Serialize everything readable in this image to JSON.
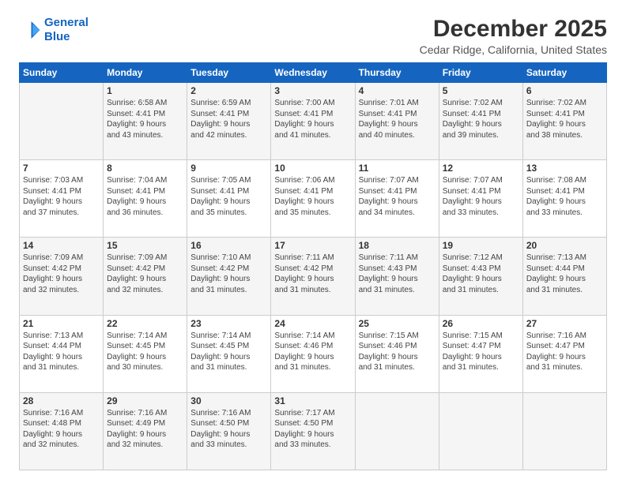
{
  "logo": {
    "line1": "General",
    "line2": "Blue"
  },
  "title": "December 2025",
  "subtitle": "Cedar Ridge, California, United States",
  "header_days": [
    "Sunday",
    "Monday",
    "Tuesday",
    "Wednesday",
    "Thursday",
    "Friday",
    "Saturday"
  ],
  "weeks": [
    [
      {
        "day": "",
        "info": ""
      },
      {
        "day": "1",
        "info": "Sunrise: 6:58 AM\nSunset: 4:41 PM\nDaylight: 9 hours\nand 43 minutes."
      },
      {
        "day": "2",
        "info": "Sunrise: 6:59 AM\nSunset: 4:41 PM\nDaylight: 9 hours\nand 42 minutes."
      },
      {
        "day": "3",
        "info": "Sunrise: 7:00 AM\nSunset: 4:41 PM\nDaylight: 9 hours\nand 41 minutes."
      },
      {
        "day": "4",
        "info": "Sunrise: 7:01 AM\nSunset: 4:41 PM\nDaylight: 9 hours\nand 40 minutes."
      },
      {
        "day": "5",
        "info": "Sunrise: 7:02 AM\nSunset: 4:41 PM\nDaylight: 9 hours\nand 39 minutes."
      },
      {
        "day": "6",
        "info": "Sunrise: 7:02 AM\nSunset: 4:41 PM\nDaylight: 9 hours\nand 38 minutes."
      }
    ],
    [
      {
        "day": "7",
        "info": "Sunrise: 7:03 AM\nSunset: 4:41 PM\nDaylight: 9 hours\nand 37 minutes."
      },
      {
        "day": "8",
        "info": "Sunrise: 7:04 AM\nSunset: 4:41 PM\nDaylight: 9 hours\nand 36 minutes."
      },
      {
        "day": "9",
        "info": "Sunrise: 7:05 AM\nSunset: 4:41 PM\nDaylight: 9 hours\nand 35 minutes."
      },
      {
        "day": "10",
        "info": "Sunrise: 7:06 AM\nSunset: 4:41 PM\nDaylight: 9 hours\nand 35 minutes."
      },
      {
        "day": "11",
        "info": "Sunrise: 7:07 AM\nSunset: 4:41 PM\nDaylight: 9 hours\nand 34 minutes."
      },
      {
        "day": "12",
        "info": "Sunrise: 7:07 AM\nSunset: 4:41 PM\nDaylight: 9 hours\nand 33 minutes."
      },
      {
        "day": "13",
        "info": "Sunrise: 7:08 AM\nSunset: 4:41 PM\nDaylight: 9 hours\nand 33 minutes."
      }
    ],
    [
      {
        "day": "14",
        "info": "Sunrise: 7:09 AM\nSunset: 4:42 PM\nDaylight: 9 hours\nand 32 minutes."
      },
      {
        "day": "15",
        "info": "Sunrise: 7:09 AM\nSunset: 4:42 PM\nDaylight: 9 hours\nand 32 minutes."
      },
      {
        "day": "16",
        "info": "Sunrise: 7:10 AM\nSunset: 4:42 PM\nDaylight: 9 hours\nand 31 minutes."
      },
      {
        "day": "17",
        "info": "Sunrise: 7:11 AM\nSunset: 4:42 PM\nDaylight: 9 hours\nand 31 minutes."
      },
      {
        "day": "18",
        "info": "Sunrise: 7:11 AM\nSunset: 4:43 PM\nDaylight: 9 hours\nand 31 minutes."
      },
      {
        "day": "19",
        "info": "Sunrise: 7:12 AM\nSunset: 4:43 PM\nDaylight: 9 hours\nand 31 minutes."
      },
      {
        "day": "20",
        "info": "Sunrise: 7:13 AM\nSunset: 4:44 PM\nDaylight: 9 hours\nand 31 minutes."
      }
    ],
    [
      {
        "day": "21",
        "info": "Sunrise: 7:13 AM\nSunset: 4:44 PM\nDaylight: 9 hours\nand 31 minutes."
      },
      {
        "day": "22",
        "info": "Sunrise: 7:14 AM\nSunset: 4:45 PM\nDaylight: 9 hours\nand 30 minutes."
      },
      {
        "day": "23",
        "info": "Sunrise: 7:14 AM\nSunset: 4:45 PM\nDaylight: 9 hours\nand 31 minutes."
      },
      {
        "day": "24",
        "info": "Sunrise: 7:14 AM\nSunset: 4:46 PM\nDaylight: 9 hours\nand 31 minutes."
      },
      {
        "day": "25",
        "info": "Sunrise: 7:15 AM\nSunset: 4:46 PM\nDaylight: 9 hours\nand 31 minutes."
      },
      {
        "day": "26",
        "info": "Sunrise: 7:15 AM\nSunset: 4:47 PM\nDaylight: 9 hours\nand 31 minutes."
      },
      {
        "day": "27",
        "info": "Sunrise: 7:16 AM\nSunset: 4:47 PM\nDaylight: 9 hours\nand 31 minutes."
      }
    ],
    [
      {
        "day": "28",
        "info": "Sunrise: 7:16 AM\nSunset: 4:48 PM\nDaylight: 9 hours\nand 32 minutes."
      },
      {
        "day": "29",
        "info": "Sunrise: 7:16 AM\nSunset: 4:49 PM\nDaylight: 9 hours\nand 32 minutes."
      },
      {
        "day": "30",
        "info": "Sunrise: 7:16 AM\nSunset: 4:50 PM\nDaylight: 9 hours\nand 33 minutes."
      },
      {
        "day": "31",
        "info": "Sunrise: 7:17 AM\nSunset: 4:50 PM\nDaylight: 9 hours\nand 33 minutes."
      },
      {
        "day": "",
        "info": ""
      },
      {
        "day": "",
        "info": ""
      },
      {
        "day": "",
        "info": ""
      }
    ]
  ]
}
